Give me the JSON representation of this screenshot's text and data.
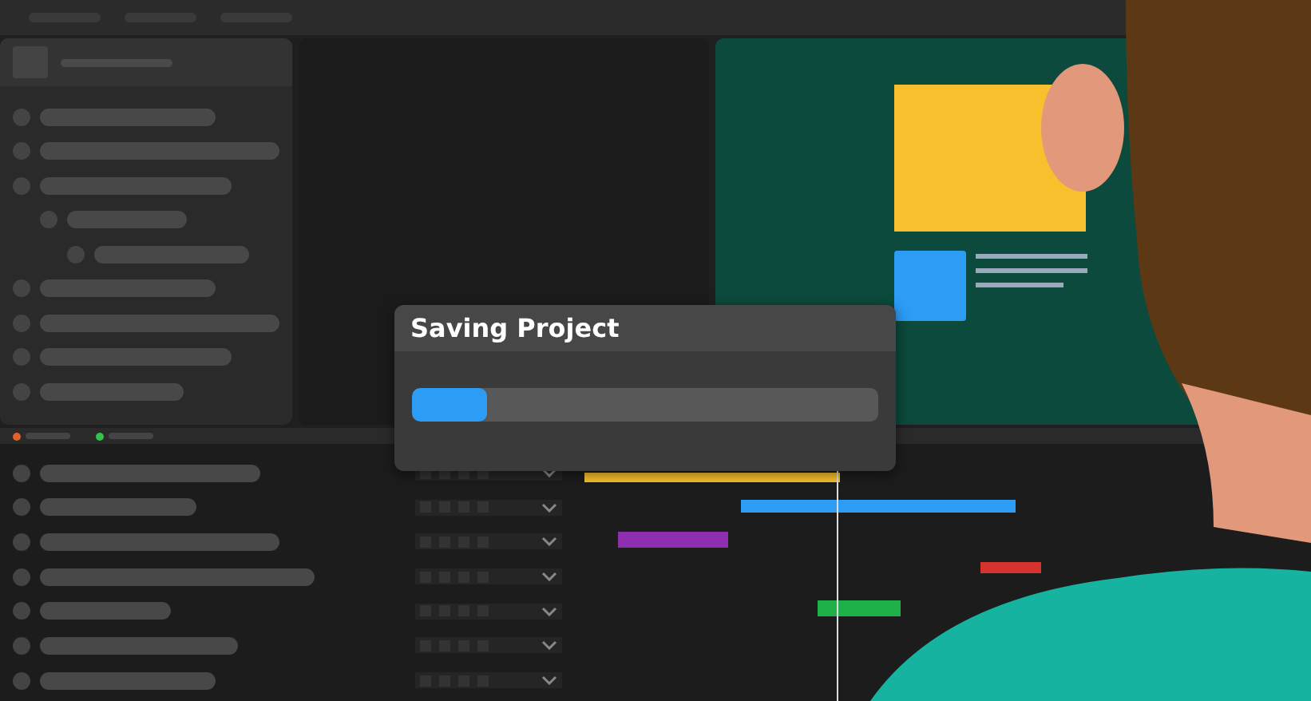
{
  "outline": {
    "items": [
      {
        "kind": "skeleton"
      },
      {
        "kind": "skeleton"
      },
      {
        "kind": "skeleton",
        "children": [
          {
            "kind": "skeleton",
            "children": [
              {
                "kind": "skeleton"
              }
            ]
          }
        ]
      },
      {
        "kind": "skeleton"
      },
      {
        "kind": "skeleton"
      },
      {
        "kind": "skeleton"
      },
      {
        "kind": "skeleton"
      }
    ]
  },
  "timeline": {
    "markers": [
      {
        "color": "#e0622a"
      },
      {
        "color": "#35c24a"
      }
    ],
    "bars": [
      {
        "color": "#f8c12c"
      },
      {
        "color": "#2d9cf5"
      },
      {
        "color": "#8e2fb0"
      },
      {
        "color": "#d6332f"
      },
      {
        "color": "#1fb04a"
      }
    ]
  },
  "dialog": {
    "title": "Saving Project",
    "progress": {
      "level": 0.16
    }
  }
}
